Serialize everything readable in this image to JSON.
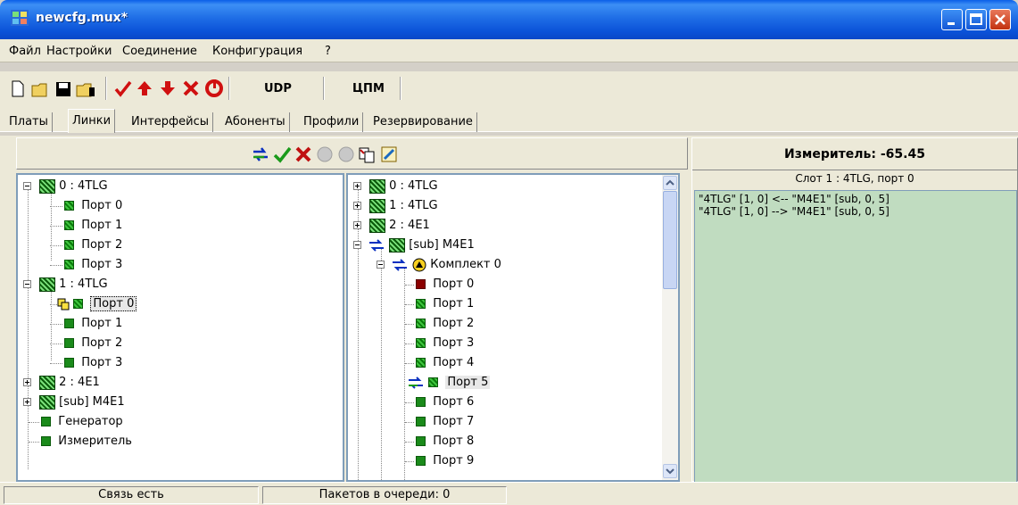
{
  "window": {
    "title": "newcfg.mux*"
  },
  "menu": [
    "Файл",
    "Настройки",
    "Соединение",
    "Конфигурация",
    "?"
  ],
  "toolbar": {
    "udp_label": "UDP",
    "cpm_label": "ЦПМ"
  },
  "tabs": [
    "Платы",
    "Линки",
    "Интерфейсы",
    "Абоненты",
    "Профили",
    "Резервирование"
  ],
  "active_tab": "Линки",
  "left_tree": {
    "board0": "0 : 4TLG",
    "board0_ports": [
      "Порт 0",
      "Порт 1",
      "Порт 2",
      "Порт 3"
    ],
    "board1": "1 : 4TLG",
    "board1_ports": [
      "Порт 0",
      "Порт 1",
      "Порт 2",
      "Порт 3"
    ],
    "board2": "2 : 4E1",
    "board3": "[sub] M4E1",
    "generator": "Генератор",
    "meter": "Измеритель"
  },
  "right_tree": {
    "board0": "0 : 4TLG",
    "board1": "1 : 4TLG",
    "board2": "2 : 4E1",
    "board3": "[sub] M4E1",
    "kit": "Комплект 0",
    "ports": [
      "Порт 0",
      "Порт 1",
      "Порт 2",
      "Порт 3",
      "Порт 4",
      "Порт 5",
      "Порт 6",
      "Порт 7",
      "Порт 8",
      "Порт 9"
    ]
  },
  "meter": {
    "title": "Измеритель: -65.45",
    "subtitle": "Слот 1 : 4TLG, порт 0",
    "log": [
      "\"4TLG\" [1, 0] <-- \"M4E1\" [sub, 0, 5]",
      "\"4TLG\" [1, 0] --> \"M4E1\" [sub, 0, 5]"
    ]
  },
  "status": {
    "connection": "Связь есть",
    "queue": "Пакетов в очереди: 0"
  }
}
